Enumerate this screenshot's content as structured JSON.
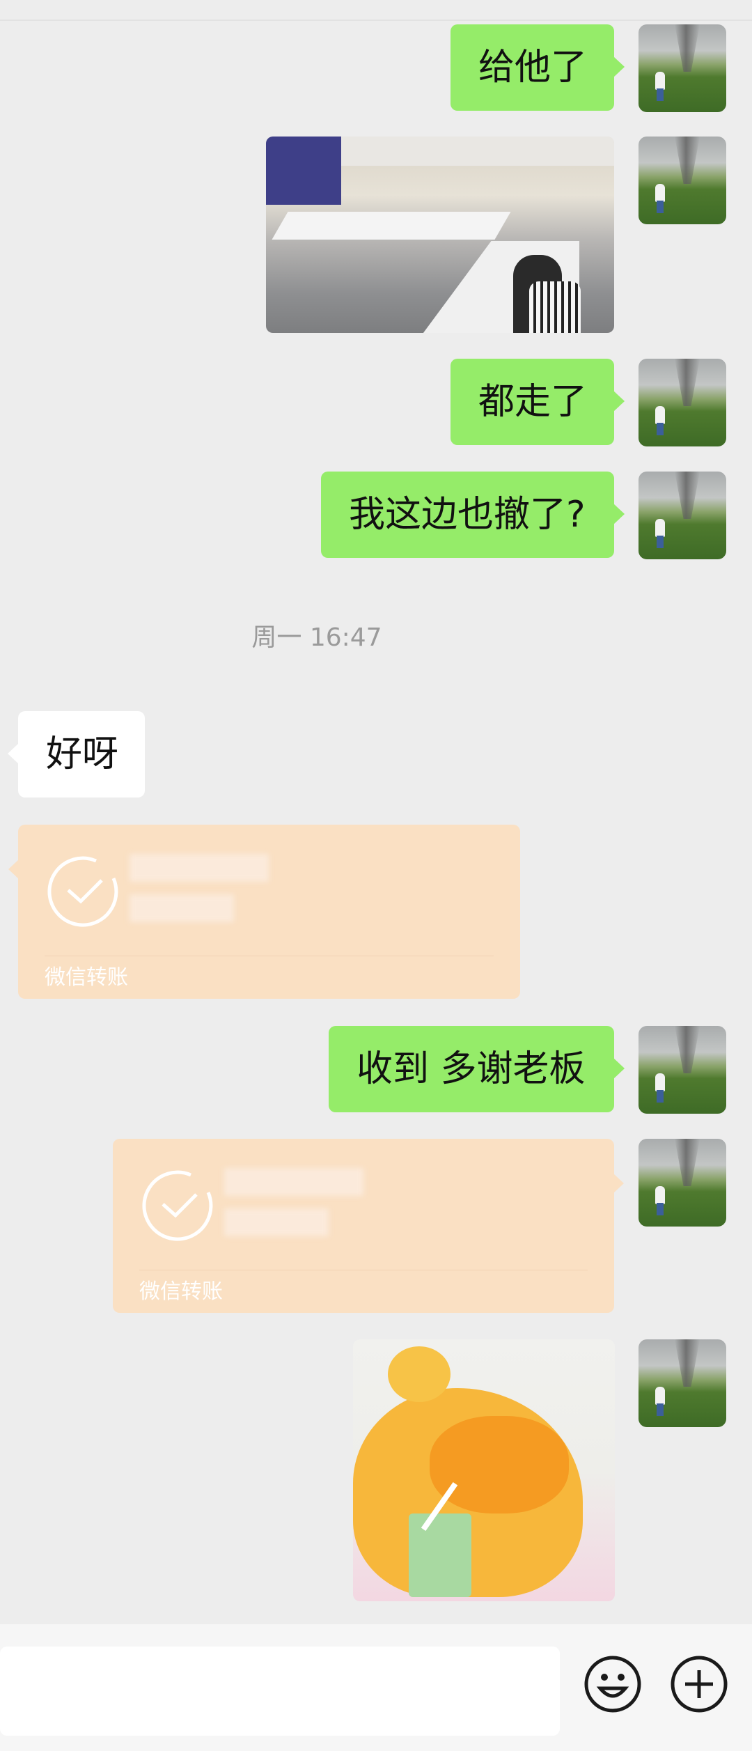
{
  "messages": [
    {
      "id": "m1",
      "direction": "out",
      "type": "text",
      "text": "给他了"
    },
    {
      "id": "m2",
      "direction": "out",
      "type": "image",
      "image": "exhibition-hall-photo"
    },
    {
      "id": "m3",
      "direction": "out",
      "type": "text",
      "text": "都走了"
    },
    {
      "id": "m4",
      "direction": "out",
      "type": "text",
      "text": "我这边也撤了?"
    },
    {
      "id": "ts",
      "type": "timestamp",
      "text": "周一 16:47"
    },
    {
      "id": "m5",
      "direction": "in",
      "type": "text",
      "text": "好呀"
    },
    {
      "id": "m6",
      "direction": "in",
      "type": "transfer",
      "label": "微信转账"
    },
    {
      "id": "m7",
      "direction": "out",
      "type": "text",
      "text": "收到 多谢老板"
    },
    {
      "id": "m8",
      "direction": "out",
      "type": "transfer",
      "label": "微信转账"
    },
    {
      "id": "m9",
      "direction": "out",
      "type": "sticker",
      "image": "orange-bear-sticker"
    }
  ],
  "avatar": {
    "icon": "tornado-field-avatar"
  },
  "input_bar": {
    "emoji_icon": "emoji-icon",
    "plus_icon": "plus-icon"
  },
  "colors": {
    "background": "#ededed",
    "outgoing_bubble": "#95ec69",
    "incoming_bubble": "#ffffff",
    "transfer_card": "#fae0c3",
    "timestamp": "#9a9a9a"
  }
}
